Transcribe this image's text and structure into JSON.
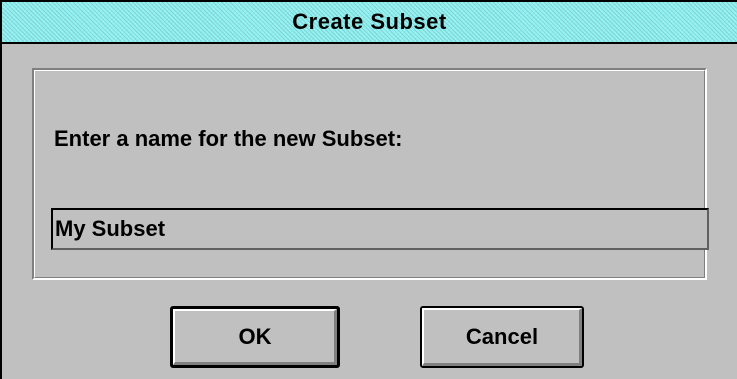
{
  "dialog": {
    "title": "Create Subset",
    "prompt": "Enter a name for the new Subset:",
    "name_field": {
      "value": "My Subset"
    },
    "ok_label": "OK",
    "cancel_label": "Cancel"
  },
  "colors": {
    "titlebar": "#8ef0f0",
    "face": "#c0c0c0",
    "text": "#000000"
  }
}
